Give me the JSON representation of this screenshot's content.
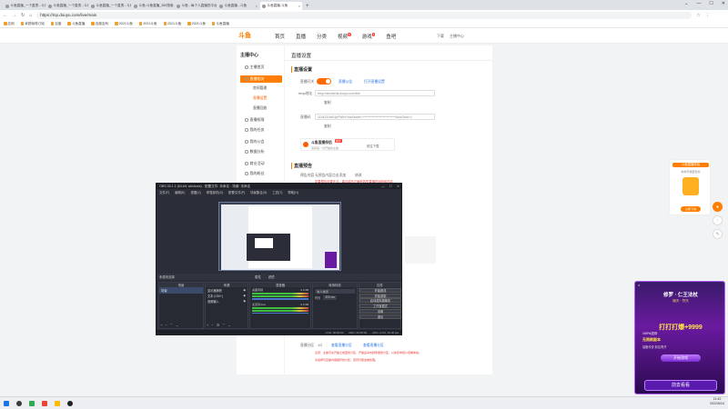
{
  "browser": {
    "tabs": [
      {
        "title": "斗鱼直播_一个直男...斗鱼一直播"
      },
      {
        "title": "斗鱼直播_一个直男...斗鱼一直播"
      },
      {
        "title": "斗鱼直播_一个直男...斗鱼一直播"
      },
      {
        "title": "斗鱼-斗鱼直播_360搜索"
      },
      {
        "title": "斗鱼 - 每个人直播的平台"
      },
      {
        "title": "斗鱼直播...斗鱼"
      },
      {
        "title": "斗鱼直播-斗鱼"
      }
    ],
    "new_tab": "+",
    "window_controls": [
      "⌄",
      "—",
      "☐",
      "✕"
    ],
    "url": "https://mp.douyu.com/live/main",
    "bookmarks": [
      "应用",
      "拿铁咖啡订阅",
      "百度",
      "斗鱼直播",
      "百度百科",
      "2021斗鱼",
      "2021斗鱼",
      "2021斗鱼",
      "2021斗鱼",
      "斗鱼直播"
    ]
  },
  "site": {
    "logo": "斗鱼",
    "nav": [
      {
        "label": "首页"
      },
      {
        "label": "直播"
      },
      {
        "label": "分类"
      },
      {
        "label": "视频",
        "badge": "5"
      },
      {
        "label": "游戏",
        "badge": "1"
      },
      {
        "label": "鱼吧"
      }
    ],
    "header_right": [
      "下载",
      "主播中心"
    ]
  },
  "sidebar": {
    "title": "主播中心",
    "items": [
      {
        "label": "主播首页"
      },
      {
        "label": "直播相关",
        "active": true
      },
      {
        "label": "房间管理",
        "sub": true
      },
      {
        "label": "直播设置",
        "sub": true,
        "highlight": true
      },
      {
        "label": "直播回放",
        "sub": true
      },
      {
        "label": "直播权限"
      },
      {
        "label": "我的任务"
      },
      {
        "label": "我的公会"
      },
      {
        "label": "数据分析"
      },
      {
        "label": "商业活动"
      },
      {
        "label": "我的粉丝"
      }
    ]
  },
  "main": {
    "page_title": "直播设置",
    "basic": {
      "title": "直播设置",
      "switch_label": "直播开关",
      "tips_link": "直播公告",
      "help_link": "打开直播设置",
      "rtmp_label": "rtmp地址",
      "rtmp_value": "rtmp://sendtc3a.douyu.com/live",
      "copy1": "复制",
      "key_label": "直播码",
      "key_value": "11342316rE4pFWKe?wsSecret=****************************&wsTime=1",
      "copy2": "复制",
      "helper_name": "斗鱼直播伴侣",
      "helper_badge": "推荐",
      "helper_desc": "适用第一次开播的主播",
      "helper_download": "前往下载"
    },
    "forecast": {
      "title": "直播预告",
      "label": "预告内容",
      "text": "无预告内容点击添加",
      "edit": "修改",
      "warning": "如果预告设置不当，建议填写正确有效的直播时间段和内容"
    },
    "bottom": {
      "label": "直播分区",
      "value": "1/2",
      "link1": "查看直播分区",
      "link2": "查看直播分区",
      "warning1": "注意：主播可在开播之前更换分区，开播后请勿频繁更换分区，以免影响观众观看体验。",
      "warning2": "请选择与直播内容相符的分区，否则可能会被处理。"
    }
  },
  "obs": {
    "title": "OBS 26.1.1 (64-bit, windows) - 配置文件: 未命名 - 场景: 未命名",
    "menu": [
      "文件(F)",
      "编辑(E)",
      "视图(V)",
      "停靠部件(D)",
      "配置文件(P)",
      "场景集合(S)",
      "工具(T)",
      "帮助(H)"
    ],
    "source_bar": "来源未选择",
    "properties": "属性",
    "filters": "滤镜",
    "docks": {
      "scenes": {
        "title": "场景",
        "items": [
          "场景"
        ]
      },
      "sources": {
        "title": "来源",
        "items": [
          "显示器捕获",
          "文本 (GDI+)",
          "音频输入"
        ]
      },
      "mixer": {
        "title": "混音器",
        "channels": [
          "桌面音频",
          "麦克风/Aux"
        ],
        "db": "0.0 dB"
      },
      "transitions": {
        "title": "转场特效",
        "type": "淡入淡出",
        "duration_label": "时长",
        "duration": "300 ms"
      },
      "controls": {
        "title": "控件",
        "buttons": [
          "开始推流",
          "开始录制",
          "启动虚拟摄像机",
          "工作室模式",
          "设置",
          "退出"
        ]
      }
    },
    "status": {
      "live": "LIVE: 00:00:00",
      "rec": "REC: 00:00:00",
      "cpu": "CPU: 2.0%, 30.00 fps"
    }
  },
  "promo_small": {
    "title": "斗鱼直播伴侣",
    "subtitle": "助你开播更轻松",
    "button": "立即下载"
  },
  "promo_big": {
    "title": "修罗 · 仁王法杖",
    "subtitle": "撼天 · 符咒",
    "headline": "打打打爆+9999",
    "line2": "100%送你",
    "line3": "无限刷副本",
    "line4": "装备传说 新区再开",
    "start": "开始游戏",
    "cta": "前去看看"
  },
  "taskbar": {
    "time": "11:42",
    "date": "2022/6/24"
  }
}
